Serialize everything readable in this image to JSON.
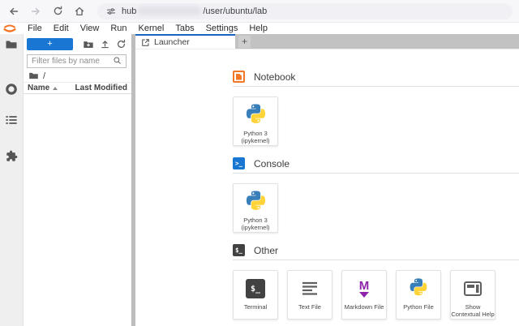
{
  "browser": {
    "url": {
      "host": "hub",
      "path": "/user/ubuntu/lab"
    }
  },
  "menubar": {
    "items": [
      "File",
      "Edit",
      "View",
      "Run",
      "Kernel",
      "Tabs",
      "Settings",
      "Help"
    ]
  },
  "activity_bar": {
    "items": [
      "file-browser",
      "running-sessions",
      "table-of-contents",
      "extensions"
    ]
  },
  "file_browser": {
    "new_launcher_label": "+",
    "filter": {
      "placeholder": "Filter files by name",
      "value": ""
    },
    "breadcrumb": {
      "root": "/"
    },
    "listing": {
      "columns": [
        {
          "label": "Name",
          "sorted": "asc"
        },
        {
          "label": "Last Modified"
        }
      ],
      "rows": []
    }
  },
  "dock": {
    "tabs": [
      {
        "label": "Launcher",
        "active": true
      }
    ],
    "add_tab_label": "+"
  },
  "launcher": {
    "sections": [
      {
        "title": "Notebook",
        "cards": [
          {
            "label": "Python 3",
            "sublabel": "(ipykernel)"
          }
        ]
      },
      {
        "title": "Console",
        "cards": [
          {
            "label": "Python 3",
            "sublabel": "(ipykernel)"
          }
        ]
      },
      {
        "title": "Other",
        "cards": [
          {
            "label": "Terminal"
          },
          {
            "label": "Text File"
          },
          {
            "label": "Markdown File"
          },
          {
            "label": "Python File"
          },
          {
            "label": "Show Contextual Help"
          }
        ]
      }
    ]
  },
  "icon_glyphs": {
    "console_prompt": ">_",
    "terminal_prompt": "$_"
  },
  "colors": {
    "accent_blue": "#1976d2",
    "active_tab_blue": "#1565c0",
    "jupyter_orange": "#f37726",
    "markdown_purple": "#8e24aa",
    "python_blue": "#387eb8",
    "python_yellow": "#ffd43b",
    "tabbar_gray": "#c2c2c2"
  }
}
